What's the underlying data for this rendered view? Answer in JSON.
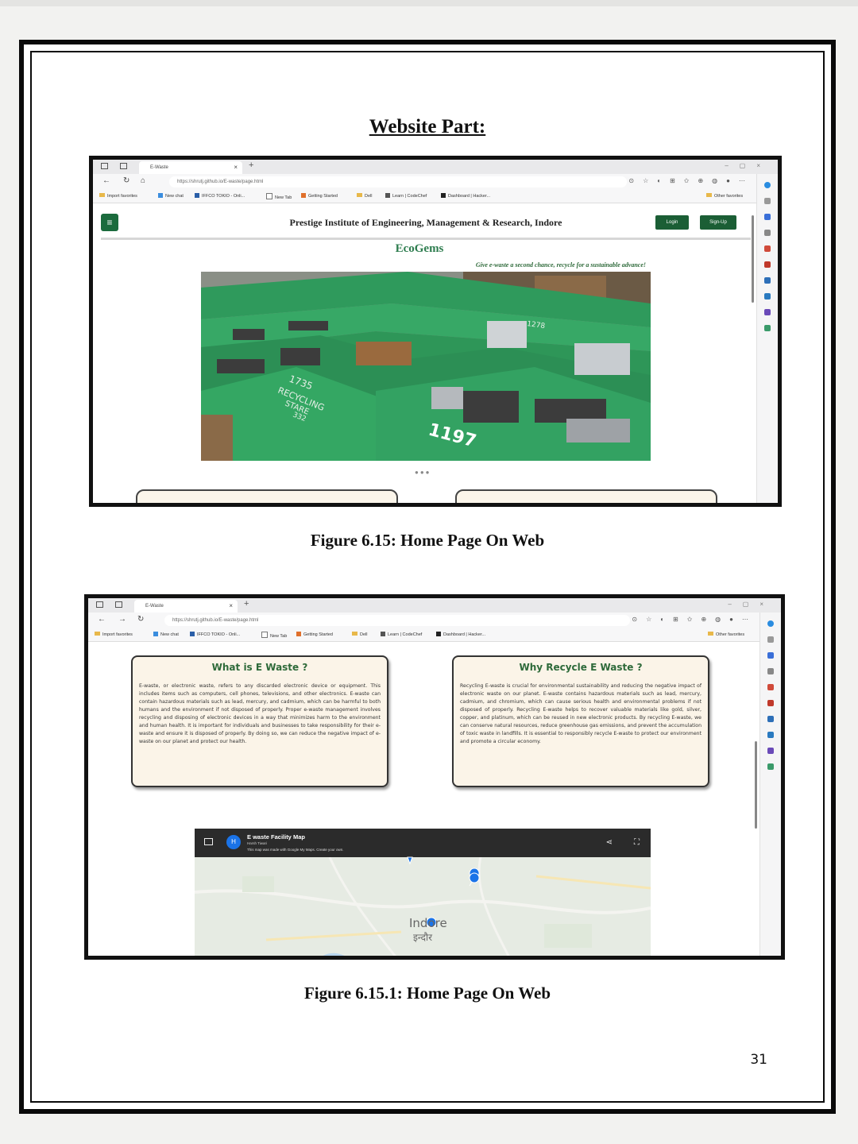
{
  "document": {
    "heading": "Website Part:",
    "caption1": "Figure 6.15: Home Page On Web",
    "caption2": "Figure 6.15.1: Home Page On Web",
    "page_number": "31"
  },
  "browser": {
    "tab_title": "E-Waste",
    "url": "https://shrutj.github.io/E-waste/page.html",
    "bookmarks": [
      "Import favorites",
      "New chat",
      "IFFCO TOKIO - Onli...",
      "New Tab",
      "Getting Started",
      "Dell",
      "Learn | CodeChef",
      "Dashboard | Hacker..."
    ],
    "other_favorites": "Other favorites"
  },
  "site": {
    "institute": "Prestige Institute of Engineering, Management & Research, Indore",
    "login_label": "Login",
    "signup_label": "Sign-Up",
    "brand": "EcoGems",
    "tagline": "Give e-waste a second chance, recycle for a sustainable advance!",
    "hero_bin_numbers": [
      "1735",
      "RECYCLING",
      "STARE",
      "332",
      "1197",
      "1278"
    ]
  },
  "cards": {
    "what_title": "What is E Waste ?",
    "what_text": "E-waste, or electronic waste, refers to any discarded electronic device or equipment. This includes items such as computers, cell phones, televisions, and other electronics. E-waste can contain hazardous materials such as lead, mercury, and cadmium, which can be harmful to both humans and the environment if not disposed of properly. Proper e-waste management involves recycling and disposing of electronic devices in a way that minimizes harm to the environment and human health. It is important for individuals and businesses to take responsibility for their e-waste and ensure it is disposed of properly. By doing so, we can reduce the negative impact of e-waste on our planet and protect our health.",
    "why_title": "Why Recycle E Waste ?",
    "why_text": "Recycling E-waste is crucial for environmental sustainability and reducing the negative impact of electronic waste on our planet. E-waste contains hazardous materials such as lead, mercury, cadmium, and chromium, which can cause serious health and environmental problems if not disposed of properly. Recycling E-waste helps to recover valuable materials like gold, silver, copper, and platinum, which can be reused in new electronic products. By recycling E-waste, we can conserve natural resources, reduce greenhouse gas emissions, and prevent the accumulation of toxic waste in landfills. It is essential to responsibly recycle E-waste to protect our environment and promote a circular economy."
  },
  "map": {
    "avatar_letter": "H",
    "title": "E waste Facility Map",
    "author": "Harsh Tiwari",
    "note": "This map was made with Google My Maps. Create your own.",
    "city_en": "Indore",
    "city_hi": "इन्दौर"
  },
  "colors": {
    "brand_green": "#2e7d4f",
    "button_green": "#1b5e35",
    "card_bg": "#fbf4e8",
    "bin_green": "#2fa863"
  }
}
